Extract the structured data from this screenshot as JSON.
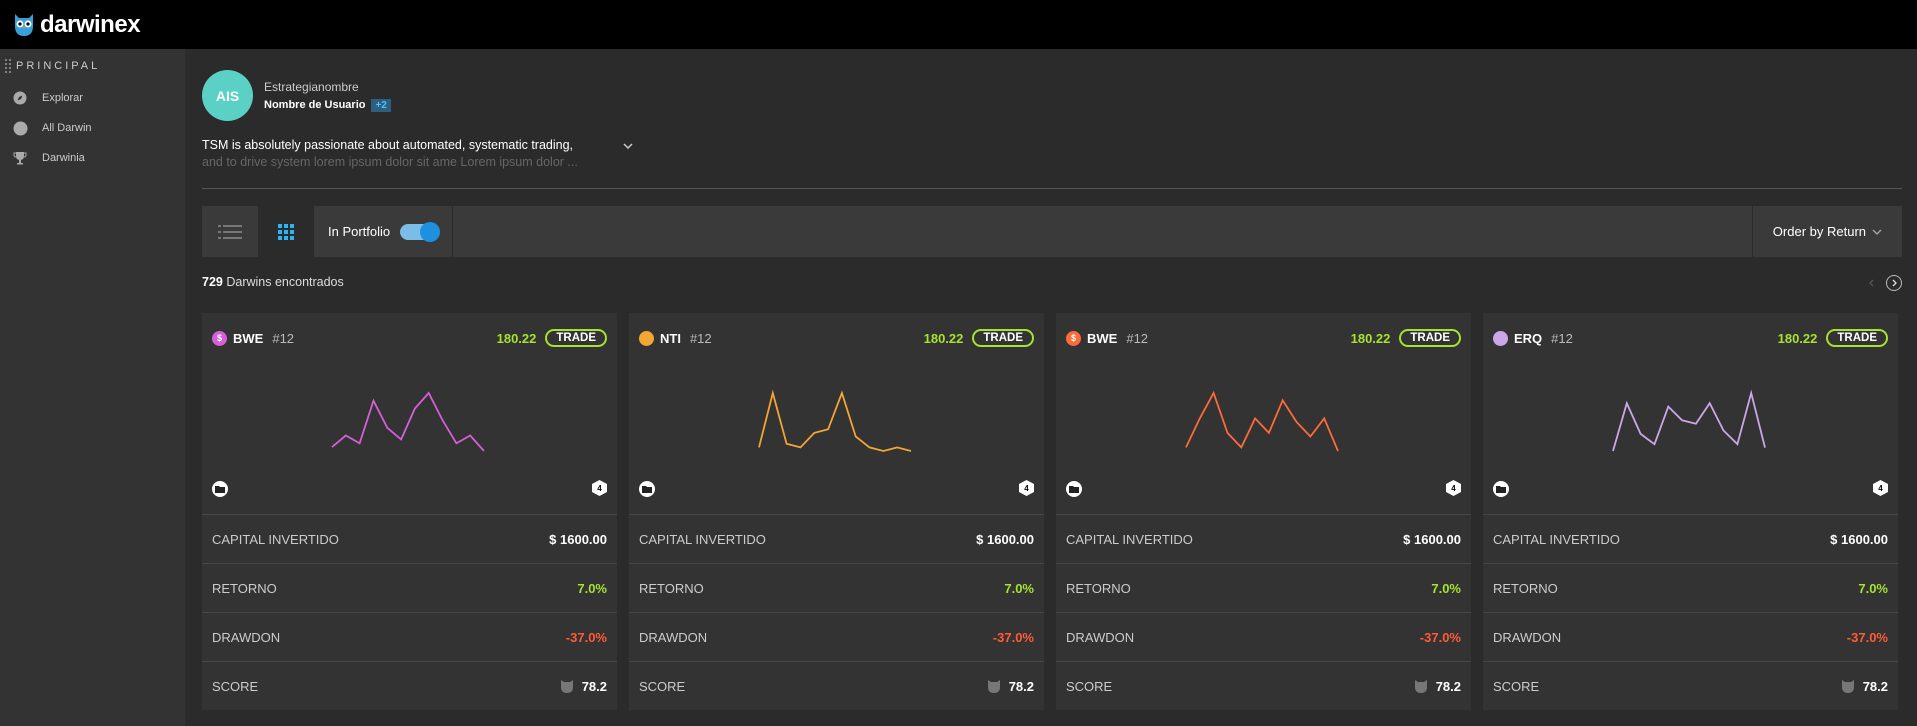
{
  "brand": {
    "name": "darwinex"
  },
  "sidebar": {
    "heading": "PRINCIPAL",
    "items": [
      {
        "label": "Explorar",
        "icon": "compass-icon"
      },
      {
        "label": "All Darwin",
        "icon": "circle-icon"
      },
      {
        "label": "Darwinia",
        "icon": "trophy-icon"
      }
    ]
  },
  "profile": {
    "initials": "AIS",
    "name": "Estrategianombre",
    "username": "Nombre de Usuario",
    "extra_badge": "+2",
    "description_line1": "TSM is absolutely passionate about automated, systematic trading,",
    "description_line2": "and to drive system lorem ipsum dolor sit ame Lorem ipsum dolor ..."
  },
  "toolbar": {
    "portfolio_label": "In Portfolio",
    "portfolio_on": true,
    "order_label": "Order by Return",
    "active_view": "grid"
  },
  "results": {
    "count": "729",
    "label": "Darwins encontrados"
  },
  "colors": {
    "accent_green": "#a6e22e",
    "negative_red": "#ff5a36",
    "avatar": "#5ad1c4"
  },
  "cards": [
    {
      "symbol": "$",
      "name": "BWE",
      "rank": "#12",
      "price": "180.22",
      "trade": "TRADE",
      "color": "#d45fd8",
      "spark": [
        2,
        5,
        3,
        14,
        7,
        4,
        12,
        16,
        9,
        3,
        5,
        1
      ],
      "rows": {
        "capital_label": "CAPITAL INVERTIDO",
        "capital": "$ 1600.00",
        "return_label": "RETORNO",
        "return": "7.0%",
        "drawdown_label": "DRAWDON",
        "drawdown": "-37.0%",
        "score_label": "SCORE",
        "score": "78.2"
      }
    },
    {
      "symbol": "",
      "name": "NTI",
      "rank": "#12",
      "price": "180.22",
      "trade": "TRADE",
      "color": "#f4a534",
      "spark": [
        2,
        17,
        3,
        2,
        6,
        7,
        17,
        5,
        2,
        1,
        2,
        1
      ],
      "rows": {
        "capital_label": "CAPITAL INVERTIDO",
        "capital": "$ 1600.00",
        "return_label": "RETORNO",
        "return": "7.0%",
        "drawdown_label": "DRAWDON",
        "drawdown": "-37.0%",
        "score_label": "SCORE",
        "score": "78.2"
      }
    },
    {
      "symbol": "$",
      "name": "BWE",
      "rank": "#12",
      "price": "180.22",
      "trade": "TRADE",
      "color": "#ff6a3a",
      "spark": [
        2,
        10,
        17,
        6,
        2,
        10,
        6,
        15,
        9,
        5,
        10,
        1
      ],
      "rows": {
        "capital_label": "CAPITAL INVERTIDO",
        "capital": "$ 1600.00",
        "return_label": "RETORNO",
        "return": "7.0%",
        "drawdown_label": "DRAWDON",
        "drawdown": "-37.0%",
        "score_label": "SCORE",
        "score": "78.2"
      }
    },
    {
      "symbol": "",
      "name": "ERQ",
      "rank": "#12",
      "price": "180.22",
      "trade": "TRADE",
      "color": "#c9a7e8",
      "spark": [
        2,
        16,
        7,
        4,
        15,
        11,
        10,
        16,
        8,
        4,
        19,
        3
      ],
      "rows": {
        "capital_label": "CAPITAL INVERTIDO",
        "capital": "$ 1600.00",
        "return_label": "RETORNO",
        "return": "7.0%",
        "drawdown_label": "DRAWDON",
        "drawdown": "-37.0%",
        "score_label": "SCORE",
        "score": "78.2"
      }
    }
  ]
}
